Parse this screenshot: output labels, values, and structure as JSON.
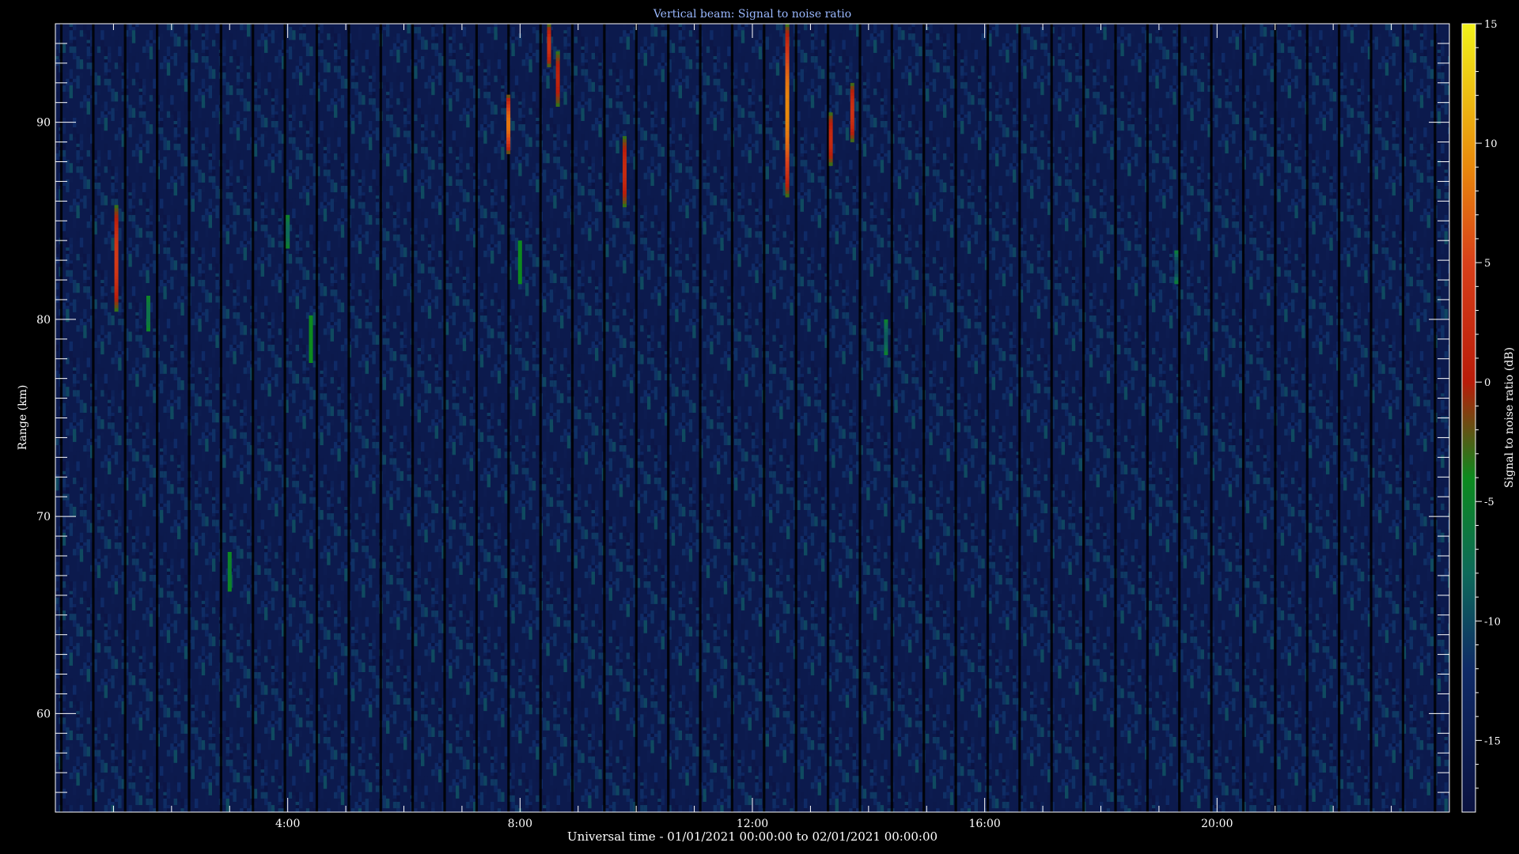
{
  "chart_data": {
    "type": "heatmap",
    "title": "Vertical beam: Signal to noise ratio",
    "xlabel": "Universal time - 01/01/2021 00:00:00 to 02/01/2021 00:00:00",
    "ylabel": "Range (km)",
    "colorbar_label": "Signal to noise ratio (dB)",
    "xlim_hours": [
      0,
      24
    ],
    "ylim_km": [
      55,
      95
    ],
    "x_ticks": [
      {
        "hour": 4,
        "label": "4:00"
      },
      {
        "hour": 8,
        "label": "8:00"
      },
      {
        "hour": 12,
        "label": "12:00"
      },
      {
        "hour": 16,
        "label": "16:00"
      },
      {
        "hour": 20,
        "label": "20:00"
      }
    ],
    "y_ticks": [
      {
        "km": 60,
        "label": "60"
      },
      {
        "km": 70,
        "label": "70"
      },
      {
        "km": 80,
        "label": "80"
      },
      {
        "km": 90,
        "label": "90"
      }
    ],
    "colorbar_range_db": [
      -18,
      15
    ],
    "colorbar_ticks": [
      {
        "db": 15,
        "label": "15"
      },
      {
        "db": 10,
        "label": "10"
      },
      {
        "db": 5,
        "label": "5"
      },
      {
        "db": 0,
        "label": "0"
      },
      {
        "db": -5,
        "label": "-5"
      },
      {
        "db": -10,
        "label": "-10"
      },
      {
        "db": -15,
        "label": "-15"
      }
    ],
    "colormap": [
      {
        "db": -18,
        "color": "#0b1240"
      },
      {
        "db": -12,
        "color": "#0f2a66"
      },
      {
        "db": -8,
        "color": "#0e6a5a"
      },
      {
        "db": -4,
        "color": "#0d8a1e"
      },
      {
        "db": 0,
        "color": "#b81c0a"
      },
      {
        "db": 5,
        "color": "#d8401a"
      },
      {
        "db": 9,
        "color": "#e8880c"
      },
      {
        "db": 15,
        "color": "#f2f21a"
      }
    ],
    "background_db": -16,
    "data_gap_interval_hours": 0.55,
    "echoes": [
      {
        "hour": 1.05,
        "km_top": 85.8,
        "km_bottom": 80.4,
        "peak_db": 4
      },
      {
        "hour": 1.6,
        "km_top": 81.2,
        "km_bottom": 79.4,
        "peak_db": -7
      },
      {
        "hour": 3.0,
        "km_top": 68.2,
        "km_bottom": 66.2,
        "peak_db": -5
      },
      {
        "hour": 4.0,
        "km_top": 85.3,
        "km_bottom": 83.6,
        "peak_db": -8
      },
      {
        "hour": 4.4,
        "km_top": 80.2,
        "km_bottom": 77.8,
        "peak_db": -4
      },
      {
        "hour": 7.8,
        "km_top": 91.4,
        "km_bottom": 88.4,
        "peak_db": 8
      },
      {
        "hour": 8.0,
        "km_top": 84.0,
        "km_bottom": 81.8,
        "peak_db": -4
      },
      {
        "hour": 8.5,
        "km_top": 95.0,
        "km_bottom": 92.8,
        "peak_db": 3
      },
      {
        "hour": 8.65,
        "km_top": 93.6,
        "km_bottom": 90.8,
        "peak_db": 1
      },
      {
        "hour": 9.8,
        "km_top": 89.3,
        "km_bottom": 85.7,
        "peak_db": 2
      },
      {
        "hour": 12.6,
        "km_top": 95.0,
        "km_bottom": 86.2,
        "peak_db": 9
      },
      {
        "hour": 13.35,
        "km_top": 90.5,
        "km_bottom": 87.8,
        "peak_db": 2
      },
      {
        "hour": 13.72,
        "km_top": 92.0,
        "km_bottom": 89.0,
        "peak_db": 3
      },
      {
        "hour": 14.3,
        "km_top": 80.0,
        "km_bottom": 78.2,
        "peak_db": -9
      },
      {
        "hour": 19.3,
        "km_top": 83.5,
        "km_bottom": 81.8,
        "peak_db": -11
      }
    ],
    "grid": false
  }
}
